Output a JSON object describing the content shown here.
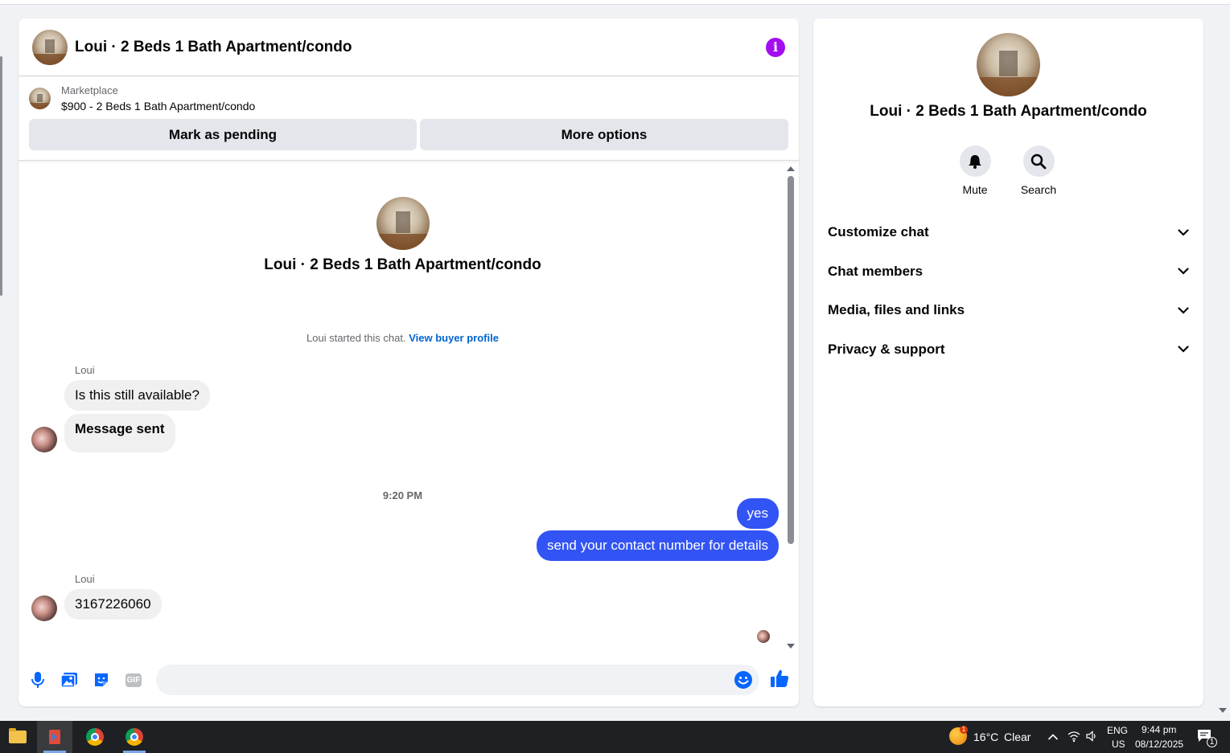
{
  "header": {
    "title": "Loui · 2 Beds 1 Bath Apartment/condo"
  },
  "marketplace": {
    "label": "Marketplace",
    "item": "$900 - 2 Beds 1 Bath Apartment/condo",
    "mark_pending": "Mark as pending",
    "more_options": "More options"
  },
  "conversation": {
    "intro_name": "Loui · 2 Beds 1 Bath Apartment/condo",
    "started_text": "Loui started this chat.",
    "view_profile": "View buyer profile",
    "messages": [
      {
        "sender": "Loui",
        "text": "Is this still available?"
      },
      {
        "text": "Message sent"
      },
      {
        "timestamp": "9:20 PM"
      },
      {
        "text": "yes"
      },
      {
        "text": "send your contact number for details"
      },
      {
        "sender": "Loui",
        "text": "3167226060"
      }
    ]
  },
  "composer": {
    "placeholder": ""
  },
  "side": {
    "name": "Loui · 2 Beds 1 Bath Apartment/condo",
    "mute_label": "Mute",
    "search_label": "Search",
    "sections": [
      "Customize chat",
      "Chat members",
      "Media, files and links",
      "Privacy & support"
    ]
  },
  "taskbar": {
    "weather_badge": "1",
    "temperature": "16°C",
    "condition": "Clear",
    "language": "ENG",
    "region": "US",
    "time": "9:44 pm",
    "date": "08/12/2025",
    "notification_count": "1"
  },
  "colors": {
    "accent_purple": "#a20ef0",
    "outgoing_bubble": "#3254f4",
    "composer_icon_blue": "#0866ff",
    "link_blue": "#0064d1"
  },
  "icons": [
    "info-icon",
    "mic-icon",
    "photo-icon",
    "sticker-icon",
    "gif-icon",
    "emoji-icon",
    "thumbs-up-icon",
    "bell-icon",
    "search-icon",
    "chevron-down-icon"
  ]
}
